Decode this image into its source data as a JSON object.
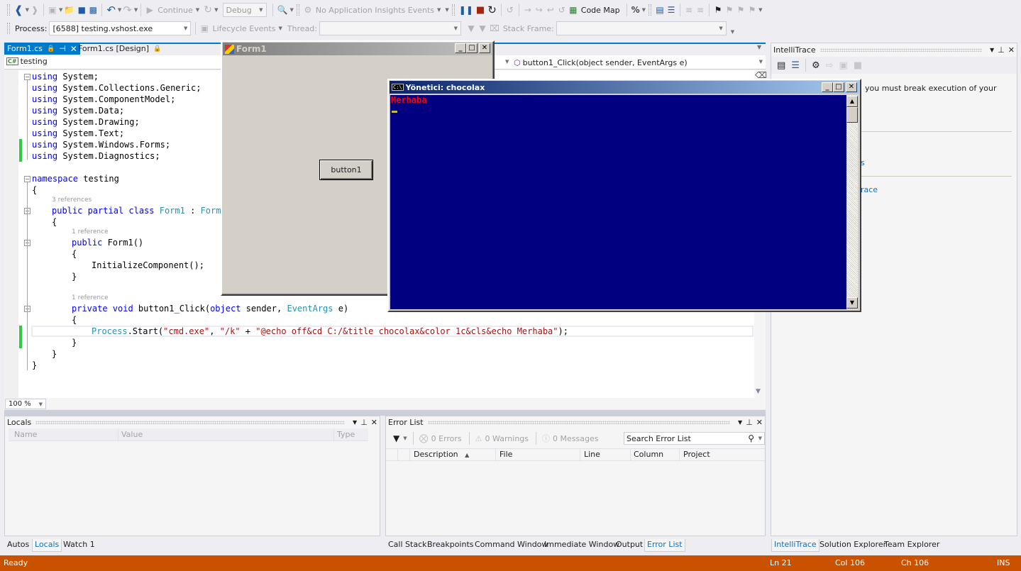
{
  "toolbar1": {
    "continue_label": "Continue",
    "config_value": "Debug",
    "insights_label": "No Application Insights Events",
    "code_map_label": "Code Map"
  },
  "toolbar2": {
    "process_label": "Process:",
    "process_value": "[6588] testing.vshost.exe",
    "lifecycle_label": "Lifecycle Events",
    "thread_label": "Thread:",
    "stack_frame_label": "Stack Frame:"
  },
  "editor": {
    "tabs": [
      {
        "label": "Form1.cs",
        "active": true
      },
      {
        "label": "Form1.cs [Design]",
        "active": false
      }
    ],
    "nav_project": "testing",
    "nav_member": "button1_Click(object sender, EventArgs e)",
    "zoom_value": "100 %",
    "code": {
      "l1": [
        "using",
        " System;"
      ],
      "l2": [
        "using",
        " System.Collections.Generic;"
      ],
      "l3": [
        "using",
        " System.ComponentModel;"
      ],
      "l4": [
        "using",
        " System.Data;"
      ],
      "l5": [
        "using",
        " System.Drawing;"
      ],
      "l6": [
        "using",
        " System.Text;"
      ],
      "l7": [
        "using",
        " System.Windows.Forms;"
      ],
      "l8": [
        "using",
        " System.Diagnostics;"
      ],
      "ns_kw": "namespace",
      "ns_name": " testing",
      "open_brace": "{",
      "close_brace": "}",
      "lens_class": "3 references",
      "class_kw": "public partial class",
      "class_name": "Form1",
      "class_sep": " : ",
      "class_base": "Form",
      "lens_ctor": "1 reference",
      "ctor_kw": "public",
      "ctor_name": " Form1()",
      "init_call": "InitializeComponent();",
      "lens_click": "1 reference",
      "click_kw": "private void",
      "click_name": " button1_Click(",
      "click_obj": "object",
      "click_sender": " sender, ",
      "click_args_type": "EventArgs",
      "click_end": " e)",
      "proc_type": "Process",
      "proc_call": ".Start(",
      "proc_s1": "\"cmd.exe\"",
      "proc_comma": ", ",
      "proc_s2": "\"/k\"",
      "proc_plus": " + ",
      "proc_s3": "\"@echo off&cd C:/&title chocolax&color 1c&cls&echo Merhaba\"",
      "proc_end": ");"
    }
  },
  "form1_window": {
    "title": "Form1",
    "button_label": "button1"
  },
  "console_window": {
    "title": "Yönetici:  chocolax",
    "output_text": "Merhaba",
    "bg_color": "#000080",
    "text_color": "#ff0000"
  },
  "intellitrace": {
    "title": "IntelliTrace",
    "message_partial": "you must break execution of your",
    "link1_partial": "s",
    "link2_partial": "race"
  },
  "locals": {
    "title": "Locals",
    "columns": [
      "Name",
      "Value",
      "Type"
    ]
  },
  "error_list": {
    "title": "Error List",
    "errors": "0 Errors",
    "warnings": "0 Warnings",
    "messages": "0 Messages",
    "search_placeholder": "Search Error List",
    "columns": [
      "Description",
      "File",
      "Line",
      "Column",
      "Project"
    ]
  },
  "bottom_tabs_left": [
    "Autos",
    "Locals",
    "Watch 1"
  ],
  "bottom_tabs_mid": [
    "Call Stack",
    "Breakpoints",
    "Command Window",
    "Immediate Window",
    "Output",
    "Error List"
  ],
  "bottom_tabs_right": [
    "IntelliTrace",
    "Solution Explorer",
    "Team Explorer"
  ],
  "status": {
    "text": "Ready",
    "ln": "Ln 21",
    "col": "Col 106",
    "ch": "Ch 106",
    "mode": "INS",
    "color": "#ca5100"
  }
}
